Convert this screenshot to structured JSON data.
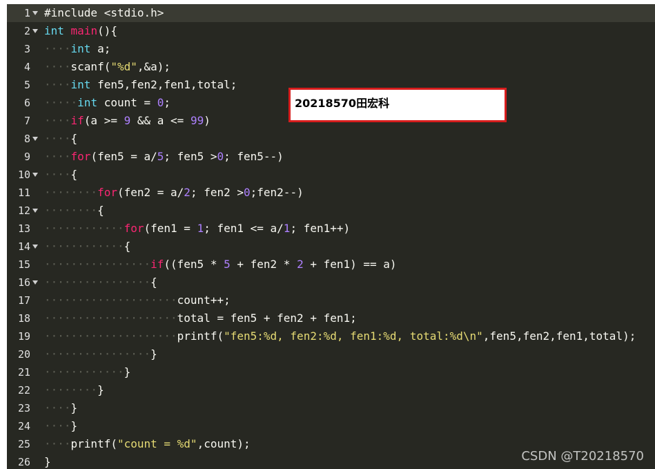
{
  "editor": {
    "lines": [
      {
        "n": "1",
        "fold": true,
        "segs": [
          [
            "t",
            "#include <stdio.h>"
          ]
        ]
      },
      {
        "n": "2",
        "fold": true,
        "segs": [
          [
            "k",
            "int"
          ],
          [
            "t",
            " "
          ],
          [
            "f",
            "main"
          ],
          [
            "t",
            "(){"
          ]
        ]
      },
      {
        "n": "3",
        "fold": false,
        "segs": [
          [
            "w",
            "····"
          ],
          [
            "k",
            "int"
          ],
          [
            "t",
            " a;"
          ]
        ]
      },
      {
        "n": "4",
        "fold": false,
        "segs": [
          [
            "w",
            "····"
          ],
          [
            "t",
            "scanf("
          ],
          [
            "s",
            "\"%d\""
          ],
          [
            "t",
            ",&a);"
          ]
        ]
      },
      {
        "n": "5",
        "fold": false,
        "segs": [
          [
            "w",
            "····"
          ],
          [
            "k",
            "int"
          ],
          [
            "t",
            " fen5,fen2,fen1,total;"
          ]
        ]
      },
      {
        "n": "6",
        "fold": false,
        "segs": [
          [
            "w",
            "·····"
          ],
          [
            "k",
            "int"
          ],
          [
            "t",
            " count = "
          ],
          [
            "n",
            "0"
          ],
          [
            "t",
            ";"
          ]
        ]
      },
      {
        "n": "7",
        "fold": false,
        "segs": [
          [
            "w",
            "····"
          ],
          [
            "f",
            "if"
          ],
          [
            "t",
            "(a >= "
          ],
          [
            "n",
            "9"
          ],
          [
            "t",
            " && a <= "
          ],
          [
            "n",
            "99"
          ],
          [
            "t",
            ")"
          ]
        ]
      },
      {
        "n": "8",
        "fold": true,
        "segs": [
          [
            "w",
            "····"
          ],
          [
            "t",
            "{"
          ]
        ]
      },
      {
        "n": "9",
        "fold": false,
        "segs": [
          [
            "w",
            "····"
          ],
          [
            "f",
            "for"
          ],
          [
            "t",
            "(fen5 = a/"
          ],
          [
            "n",
            "5"
          ],
          [
            "t",
            "; fen5 >"
          ],
          [
            "n",
            "0"
          ],
          [
            "t",
            "; fen5--)"
          ]
        ]
      },
      {
        "n": "10",
        "fold": true,
        "segs": [
          [
            "w",
            "····"
          ],
          [
            "t",
            "{"
          ]
        ]
      },
      {
        "n": "11",
        "fold": false,
        "segs": [
          [
            "w",
            "········"
          ],
          [
            "f",
            "for"
          ],
          [
            "t",
            "(fen2 = a/"
          ],
          [
            "n",
            "2"
          ],
          [
            "t",
            "; fen2 >"
          ],
          [
            "n",
            "0"
          ],
          [
            "t",
            ";fen2--)"
          ]
        ]
      },
      {
        "n": "12",
        "fold": true,
        "segs": [
          [
            "w",
            "········"
          ],
          [
            "t",
            "{"
          ]
        ]
      },
      {
        "n": "13",
        "fold": false,
        "segs": [
          [
            "w",
            "············"
          ],
          [
            "f",
            "for"
          ],
          [
            "t",
            "(fen1 = "
          ],
          [
            "n",
            "1"
          ],
          [
            "t",
            "; fen1 <= a/"
          ],
          [
            "n",
            "1"
          ],
          [
            "t",
            "; fen1++)"
          ]
        ]
      },
      {
        "n": "14",
        "fold": true,
        "segs": [
          [
            "w",
            "············"
          ],
          [
            "t",
            "{"
          ]
        ]
      },
      {
        "n": "15",
        "fold": false,
        "segs": [
          [
            "w",
            "················"
          ],
          [
            "f",
            "if"
          ],
          [
            "t",
            "((fen5 * "
          ],
          [
            "n",
            "5"
          ],
          [
            "t",
            " + fen2 * "
          ],
          [
            "n",
            "2"
          ],
          [
            "t",
            " + fen1) == a)"
          ]
        ]
      },
      {
        "n": "16",
        "fold": true,
        "segs": [
          [
            "w",
            "················"
          ],
          [
            "t",
            "{"
          ]
        ]
      },
      {
        "n": "17",
        "fold": false,
        "segs": [
          [
            "w",
            "····················"
          ],
          [
            "t",
            "count++;"
          ]
        ]
      },
      {
        "n": "18",
        "fold": false,
        "segs": [
          [
            "w",
            "····················"
          ],
          [
            "t",
            "total = fen5 + fen2 + fen1;"
          ]
        ]
      },
      {
        "n": "19",
        "fold": false,
        "segs": [
          [
            "w",
            "····················"
          ],
          [
            "t",
            "printf("
          ],
          [
            "s",
            "\"fen5:%d, fen2:%d, fen1:%d, total:%d\\n\""
          ],
          [
            "t",
            ",fen5,fen2,fen1,total);"
          ]
        ]
      },
      {
        "n": "20",
        "fold": false,
        "segs": [
          [
            "w",
            "················"
          ],
          [
            "t",
            "}"
          ]
        ]
      },
      {
        "n": "21",
        "fold": false,
        "segs": [
          [
            "w",
            "············"
          ],
          [
            "t",
            "}"
          ]
        ]
      },
      {
        "n": "22",
        "fold": false,
        "segs": [
          [
            "w",
            "········"
          ],
          [
            "t",
            "}"
          ]
        ]
      },
      {
        "n": "23",
        "fold": false,
        "segs": [
          [
            "w",
            "····"
          ],
          [
            "t",
            "}"
          ]
        ]
      },
      {
        "n": "24",
        "fold": false,
        "segs": [
          [
            "w",
            "····"
          ],
          [
            "t",
            "}"
          ]
        ]
      },
      {
        "n": "25",
        "fold": false,
        "segs": [
          [
            "w",
            "····"
          ],
          [
            "t",
            "printf("
          ],
          [
            "s",
            "\"count = %d\""
          ],
          [
            "t",
            ",count);"
          ]
        ]
      },
      {
        "n": "26",
        "fold": false,
        "segs": [
          [
            "t",
            "}"
          ]
        ]
      }
    ],
    "active_line": "1"
  },
  "overlay": {
    "author_label": "20218570田宏科"
  },
  "watermark": {
    "text": "CSDN @T20218570"
  },
  "colors": {
    "background": "#272822",
    "keyword": "#66d9ef",
    "function_control": "#f92672",
    "number": "#ae81ff",
    "string": "#e6db74"
  }
}
